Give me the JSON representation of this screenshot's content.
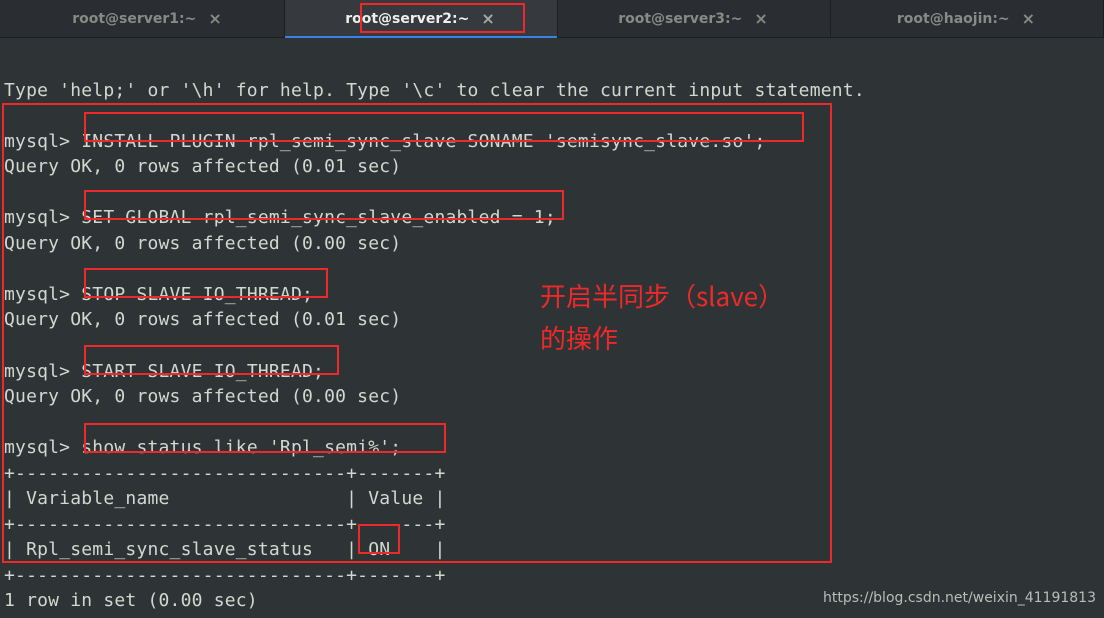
{
  "tabs": [
    {
      "label": "root@server1:~",
      "active": false
    },
    {
      "label": "root@server2:~",
      "active": true
    },
    {
      "label": "root@server3:~",
      "active": false
    },
    {
      "label": "root@haojin:~",
      "active": false
    }
  ],
  "terminal": {
    "help_line": "Type 'help;' or '\\h' for help. Type '\\c' to clear the current input statement.",
    "blank1": "",
    "cmd1_prompt": "mysql> ",
    "cmd1": "INSTALL PLUGIN rpl_semi_sync_slave SONAME 'semisync_slave.so';",
    "res1": "Query OK, 0 rows affected (0.01 sec)",
    "blank2": "",
    "cmd2_prompt": "mysql> ",
    "cmd2": "SET GLOBAL rpl_semi_sync_slave_enabled = 1;",
    "res2": "Query OK, 0 rows affected (0.00 sec)",
    "blank3": "",
    "cmd3_prompt": "mysql> ",
    "cmd3": "STOP SLAVE IO_THREAD;",
    "res3": "Query OK, 0 rows affected (0.01 sec)",
    "blank4": "",
    "cmd4_prompt": "mysql> ",
    "cmd4": "START SLAVE IO_THREAD;",
    "res4": "Query OK, 0 rows affected (0.00 sec)",
    "blank5": "",
    "cmd5_prompt": "mysql> ",
    "cmd5": "show status like 'Rpl_semi%';",
    "tbl_border": "+------------------------------+-------+",
    "tbl_header": "| Variable_name                | Value |",
    "tbl_row": "| Rpl_semi_sync_slave_status   | ON    |",
    "tbl_footer": "1 row in set (0.00 sec)"
  },
  "annotation": {
    "line1": "开启半同步（slave）",
    "line2": "的操作"
  },
  "watermark": "https://blog.csdn.net/weixin_41191813"
}
